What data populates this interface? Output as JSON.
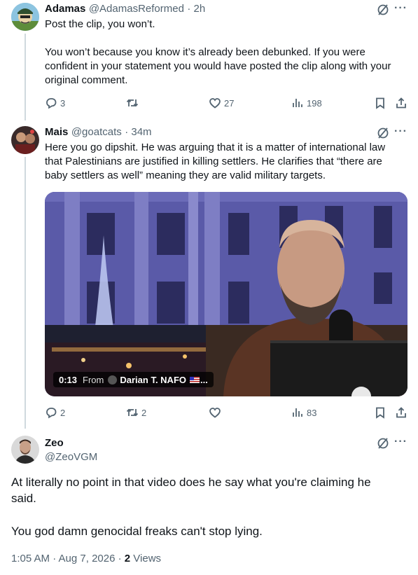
{
  "tweet1": {
    "name": "Adamas",
    "handle": "@AdamasReformed",
    "time": "· 2h",
    "line1": "Post the clip, you won’t.",
    "line2": "You won’t because you know it’s already been debunked. If you were",
    "line3": "confident in your statement you would have posted the clip along with your",
    "line4": "original comment.",
    "replies": "3",
    "retweets": "",
    "likes": "27",
    "views": "198"
  },
  "tweet2": {
    "name": "Mais",
    "handle": "@goatcats",
    "time": "· 34m",
    "line1": "Here you go dipshit. He was arguing that it is a matter of international law",
    "line2": "that Palestinians are justified in killing settlers. He clarifies that “there are",
    "line3": "baby settlers as well” meaning they are valid military targets.",
    "video": {
      "duration": "0:13",
      "from_label": "From",
      "source": "Darian T. NAFO",
      "source_suffix": "..."
    },
    "replies": "2",
    "retweets": "2",
    "likes": "",
    "views": "83"
  },
  "main": {
    "name": "Zeo",
    "handle": "@ZeoVGM",
    "line1": "At literally no point in that video does he say what you're claiming he",
    "line2": "said.",
    "line3": "You god damn genocidal freaks can't stop lying.",
    "timestamp": "1:05 AM · Aug 7, 2026 · ",
    "views_count": "2",
    "views_label": " Views"
  },
  "icons": {
    "reply": "reply-icon",
    "retweet": "retweet-icon",
    "like": "heart-icon",
    "views": "analytics-icon",
    "bookmark": "bookmark-icon",
    "share": "share-icon",
    "grok": "grok-icon",
    "more": "more-icon"
  },
  "colors": {
    "text": "#0f1419",
    "secondary": "#536471",
    "thread_line": "#cfd9de"
  }
}
